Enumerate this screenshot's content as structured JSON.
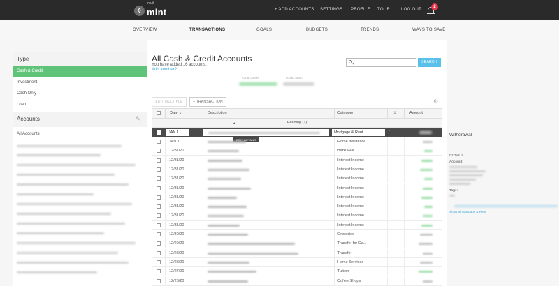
{
  "brand": {
    "intuit": "intuit",
    "mint": "mint"
  },
  "topnav": [
    "+ ADD ACCOUNTS",
    "SETTINGS",
    "PROFILE",
    "TOUR",
    "LOG OUT"
  ],
  "notifications_count": "2",
  "subnav": {
    "items": [
      "OVERVIEW",
      "TRANSACTIONS",
      "GOALS",
      "BUDGETS",
      "TRENDS",
      "WAYS TO SAVE"
    ],
    "active": "TRANSACTIONS"
  },
  "sidebar": {
    "type_heading": "Type",
    "types": [
      "Cash & Credit",
      "Investment",
      "Cash Only",
      "Loan"
    ],
    "selected_type": "Cash & Credit",
    "accounts_heading": "Accounts",
    "all_accounts": "All Accounts"
  },
  "main": {
    "title": "All Cash & Credit Accounts",
    "subtitle": "You have added 16 accounts.",
    "add_link": "Add another?",
    "search_placeholder": "",
    "search_button": "SEARCH",
    "total_cash_label": "TOTAL CASH",
    "total_debt_label": "TOTAL DEBT",
    "edit_multiple_label": "EDIT MULTIPLE",
    "add_transaction_label": "+ TRANSACTION"
  },
  "table": {
    "columns": [
      "Date",
      "Description",
      "Category",
      "Amount"
    ],
    "pending_label": "Pending (1)",
    "edit_row": {
      "date": "JAN 1",
      "category": "Mortgage & Rent",
      "edit_details": "EDIT DETAILS"
    },
    "rows": [
      {
        "date": "JAN 1",
        "category": "Home Insurance"
      },
      {
        "date": "12/31/20",
        "category": "Bank Fee"
      },
      {
        "date": "12/31/20",
        "category": "Interest Income"
      },
      {
        "date": "12/31/20",
        "category": "Interest Income"
      },
      {
        "date": "12/31/20",
        "category": "Interest Income"
      },
      {
        "date": "12/31/20",
        "category": "Interest Income"
      },
      {
        "date": "12/31/20",
        "category": "Interest Income"
      },
      {
        "date": "12/31/20",
        "category": "Interest Income"
      },
      {
        "date": "12/31/20",
        "category": "Interest Income"
      },
      {
        "date": "12/31/20",
        "category": "Interest Income"
      },
      {
        "date": "12/30/20",
        "category": "Groceries"
      },
      {
        "date": "12/29/20",
        "category": "Transfer for Ca..."
      },
      {
        "date": "12/28/20",
        "category": "Transfer"
      },
      {
        "date": "12/28/20",
        "category": "Home Services"
      },
      {
        "date": "12/27/20",
        "category": "Tuition"
      },
      {
        "date": "12/26/20",
        "category": "Coffee Shops"
      }
    ]
  },
  "right_panel": {
    "title": "Withdrawal",
    "details_label": "DETAILS",
    "account_label": "Account:",
    "tags_label": "Tags:",
    "show_all_link_2": "Show all Mortgage & Rent"
  },
  "colors": {
    "accent_green": "#5fc479",
    "link_blue": "#3ea8d8",
    "topbar": "#2a2a2a"
  }
}
